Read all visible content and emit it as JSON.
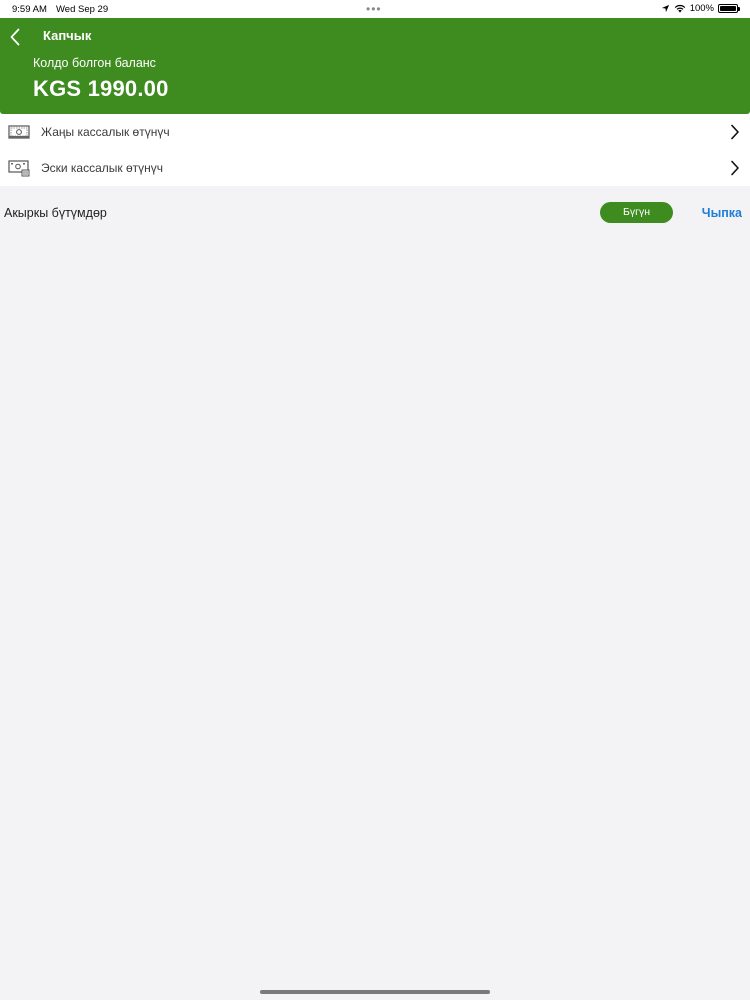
{
  "status_bar": {
    "time": "9:59 AM",
    "date": "Wed Sep 29",
    "battery": "100%",
    "dots": "•••"
  },
  "header": {
    "title": "Капчык",
    "balance_label": "Колдо болгон баланс",
    "balance_amount": "KGS 1990.00",
    "brand_color": "#3e8b20"
  },
  "menu": {
    "items": [
      {
        "label": "Жаңы кассалык өтүнүч",
        "icon": "cash-new-icon"
      },
      {
        "label": "Эски кассалык өтүнүч",
        "icon": "cash-old-icon"
      }
    ]
  },
  "transactions": {
    "title": "Акыркы бүтүмдөр",
    "filter_button": "Бүгүн",
    "exit_link": "Чыпка",
    "link_color": "#1d7fd6"
  }
}
